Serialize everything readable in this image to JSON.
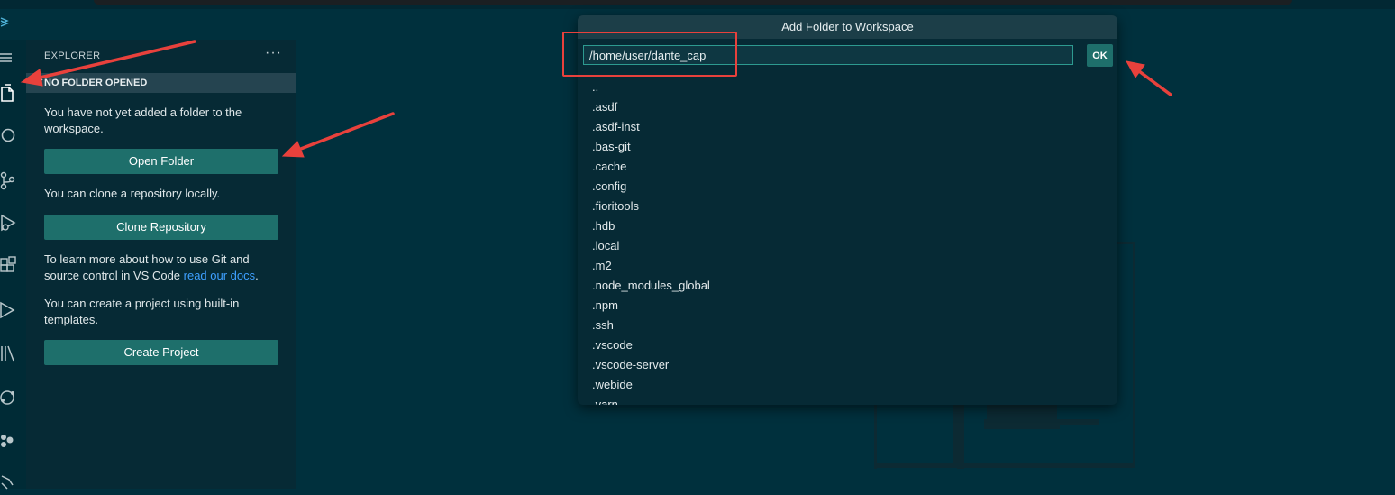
{
  "sidebar": {
    "header": "EXPLORER",
    "more": "···",
    "section_title": "NO FOLDER OPENED",
    "text1": "You have not yet added a folder to the workspace.",
    "open_folder": "Open Folder",
    "text2": "You can clone a repository locally.",
    "clone_repo": "Clone Repository",
    "text3_before": "To learn more about how to use Git and source control in VS Code ",
    "text3_link": "read our docs",
    "text3_after": ".",
    "text4": "You can create a project using built-in templates.",
    "create_project": "Create Project"
  },
  "dialog": {
    "title": "Add Folder to Workspace",
    "path_value": "/home/user/dante_cap",
    "ok_label": "OK",
    "items": [
      "..",
      ".asdf",
      ".asdf-inst",
      ".bas-git",
      ".cache",
      ".config",
      ".fioritools",
      ".hdb",
      ".local",
      ".m2",
      ".node_modules_global",
      ".npm",
      ".ssh",
      ".vscode",
      ".vscode-server",
      ".webide",
      ".yarn"
    ]
  },
  "colors": {
    "background": "#00303d",
    "sidebar": "#062a35",
    "button": "#1e6f6b",
    "annotation": "#e8413c",
    "link": "#3ea0ff"
  },
  "icons": [
    "menu-icon",
    "explorer-icon",
    "search-icon",
    "source-control-icon",
    "run-debug-icon",
    "extensions-icon",
    "run-icon",
    "library-icon",
    "remote-icon",
    "cloud-icon",
    "more-icon"
  ]
}
